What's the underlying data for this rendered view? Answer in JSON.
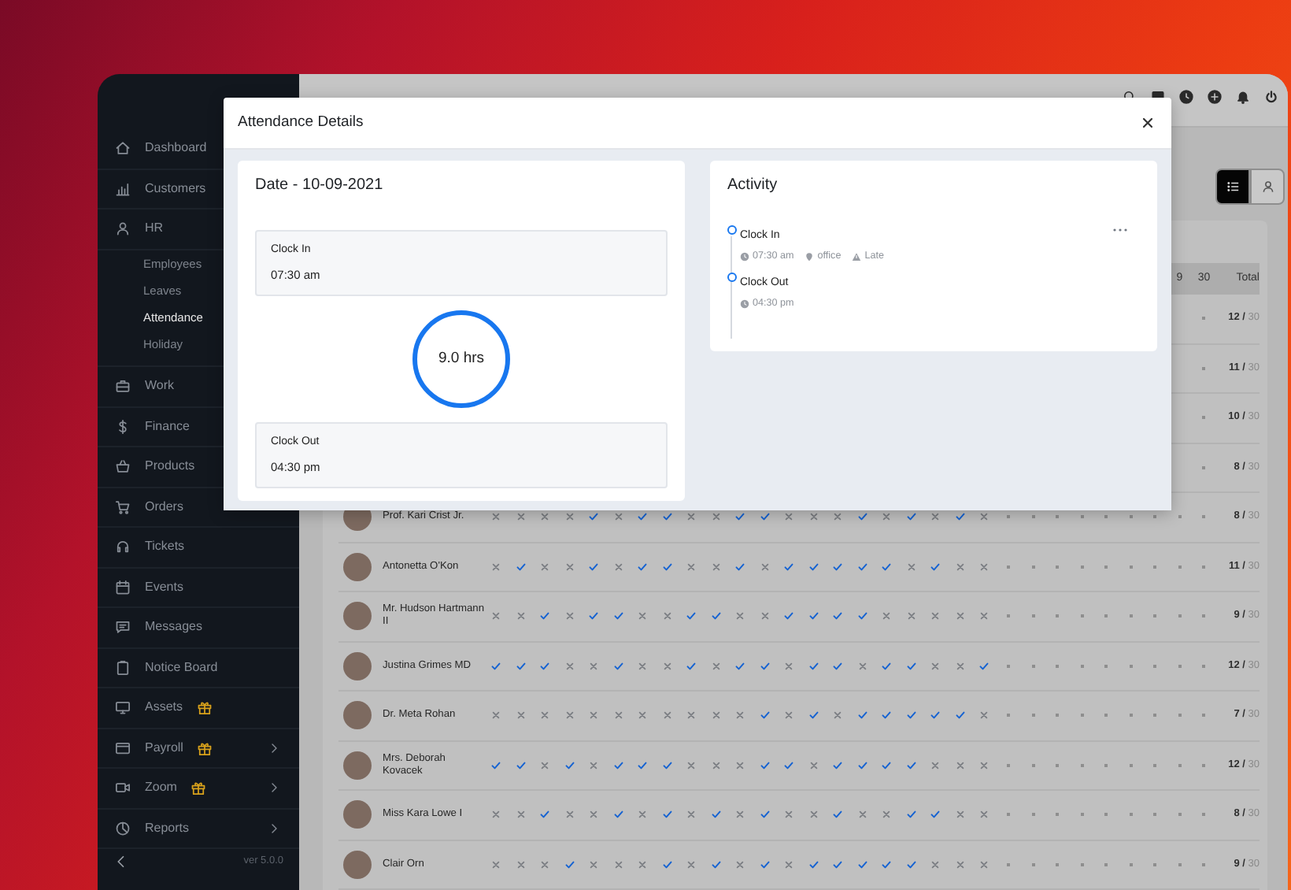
{
  "sidebar": {
    "items": [
      {
        "label": "Dashboard",
        "selected": false,
        "gift": false,
        "submenu": false
      },
      {
        "label": "Customers",
        "selected": false,
        "gift": false,
        "submenu": false
      },
      {
        "label": "HR",
        "selected": false,
        "gift": false,
        "submenu": false,
        "children": [
          {
            "label": "Employees",
            "selected": false
          },
          {
            "label": "Leaves",
            "selected": false
          },
          {
            "label": "Attendance",
            "selected": true
          },
          {
            "label": "Holiday",
            "selected": false
          }
        ]
      },
      {
        "label": "Work",
        "selected": false,
        "gift": false,
        "submenu": false
      },
      {
        "label": "Finance",
        "selected": false,
        "gift": false,
        "submenu": false
      },
      {
        "label": "Products",
        "selected": false,
        "gift": false,
        "submenu": false
      },
      {
        "label": "Orders",
        "selected": false,
        "gift": false,
        "submenu": false
      },
      {
        "label": "Tickets",
        "selected": false,
        "gift": false,
        "submenu": false
      },
      {
        "label": "Events",
        "selected": false,
        "gift": false,
        "submenu": false
      },
      {
        "label": "Messages",
        "selected": false,
        "gift": false,
        "submenu": false
      },
      {
        "label": "Notice Board",
        "selected": false,
        "gift": false,
        "submenu": false
      },
      {
        "label": "Assets",
        "selected": false,
        "gift": true,
        "submenu": false
      },
      {
        "label": "Payroll",
        "selected": false,
        "gift": true,
        "submenu": true
      },
      {
        "label": "Zoom",
        "selected": false,
        "gift": true,
        "submenu": true
      },
      {
        "label": "Reports",
        "selected": false,
        "gift": false,
        "submenu": true
      }
    ],
    "version": "ver 5.0.0"
  },
  "view_toggle": [
    {
      "selected": true
    },
    {
      "selected": false
    }
  ],
  "table": {
    "day_headings": [
      "9",
      "30"
    ],
    "total_heading": "Total",
    "rows": [
      {
        "days": [
          {
            "kind": "none"
          }
        ],
        "total": "**12 /** 30"
      },
      {
        "days": [
          {
            "kind": "none"
          }
        ],
        "total": "**11 /** 30"
      },
      {
        "days": [
          {
            "kind": "none"
          }
        ],
        "total": "**10 /** 30"
      },
      {
        "days": [
          {
            "kind": "none"
          }
        ],
        "total": "**8 /** 30"
      },
      {
        "name": "Prof. Kari Crist Jr.",
        "days": [
          {
            "kind": "absent"
          },
          {
            "kind": "absent"
          },
          {
            "kind": "absent"
          },
          {
            "kind": "absent"
          },
          {
            "kind": "present"
          },
          {
            "kind": "absent"
          },
          {
            "kind": "present"
          },
          {
            "kind": "present"
          },
          {
            "kind": "absent"
          },
          {
            "kind": "absent"
          },
          {
            "kind": "present"
          },
          {
            "kind": "present"
          },
          {
            "kind": "absent"
          },
          {
            "kind": "absent"
          },
          {
            "kind": "absent"
          },
          {
            "kind": "present"
          },
          {
            "kind": "absent"
          },
          {
            "kind": "present"
          },
          {
            "kind": "absent"
          },
          {
            "kind": "present"
          },
          {
            "kind": "absent"
          },
          {
            "kind": "none"
          },
          {
            "kind": "none"
          },
          {
            "kind": "none"
          },
          {
            "kind": "none"
          },
          {
            "kind": "none"
          },
          {
            "kind": "none"
          },
          {
            "kind": "none"
          },
          {
            "kind": "none"
          },
          {
            "kind": "none"
          }
        ],
        "total": "**8 /** 30"
      },
      {
        "name": "Antonetta O'Kon",
        "days": [
          {
            "kind": "absent"
          },
          {
            "kind": "present"
          },
          {
            "kind": "absent"
          },
          {
            "kind": "absent"
          },
          {
            "kind": "present"
          },
          {
            "kind": "absent"
          },
          {
            "kind": "present"
          },
          {
            "kind": "present"
          },
          {
            "kind": "absent"
          },
          {
            "kind": "absent"
          },
          {
            "kind": "present"
          },
          {
            "kind": "absent"
          },
          {
            "kind": "present"
          },
          {
            "kind": "present"
          },
          {
            "kind": "present"
          },
          {
            "kind": "present"
          },
          {
            "kind": "present"
          },
          {
            "kind": "absent"
          },
          {
            "kind": "present"
          },
          {
            "kind": "absent"
          },
          {
            "kind": "absent"
          },
          {
            "kind": "none"
          },
          {
            "kind": "none"
          },
          {
            "kind": "none"
          },
          {
            "kind": "none"
          },
          {
            "kind": "none"
          },
          {
            "kind": "none"
          },
          {
            "kind": "none"
          },
          {
            "kind": "none"
          },
          {
            "kind": "none"
          }
        ],
        "total": "**11 /** 30"
      },
      {
        "name": "Mr. Hudson Hartmann II",
        "days": [
          {
            "kind": "absent"
          },
          {
            "kind": "absent"
          },
          {
            "kind": "present"
          },
          {
            "kind": "absent"
          },
          {
            "kind": "present"
          },
          {
            "kind": "present"
          },
          {
            "kind": "absent"
          },
          {
            "kind": "absent"
          },
          {
            "kind": "present"
          },
          {
            "kind": "present"
          },
          {
            "kind": "absent"
          },
          {
            "kind": "absent"
          },
          {
            "kind": "present"
          },
          {
            "kind": "present"
          },
          {
            "kind": "present"
          },
          {
            "kind": "present"
          },
          {
            "kind": "absent"
          },
          {
            "kind": "absent"
          },
          {
            "kind": "absent"
          },
          {
            "kind": "absent"
          },
          {
            "kind": "absent"
          },
          {
            "kind": "none"
          },
          {
            "kind": "none"
          },
          {
            "kind": "none"
          },
          {
            "kind": "none"
          },
          {
            "kind": "none"
          },
          {
            "kind": "none"
          },
          {
            "kind": "none"
          },
          {
            "kind": "none"
          },
          {
            "kind": "none"
          }
        ],
        "total": "**9 /** 30"
      },
      {
        "name": "Justina Grimes MD",
        "days": [
          {
            "kind": "present"
          },
          {
            "kind": "present"
          },
          {
            "kind": "present"
          },
          {
            "kind": "absent"
          },
          {
            "kind": "absent"
          },
          {
            "kind": "present"
          },
          {
            "kind": "absent"
          },
          {
            "kind": "absent"
          },
          {
            "kind": "present"
          },
          {
            "kind": "absent"
          },
          {
            "kind": "present"
          },
          {
            "kind": "present"
          },
          {
            "kind": "absent"
          },
          {
            "kind": "present"
          },
          {
            "kind": "present"
          },
          {
            "kind": "absent"
          },
          {
            "kind": "present"
          },
          {
            "kind": "present"
          },
          {
            "kind": "absent"
          },
          {
            "kind": "absent"
          },
          {
            "kind": "present"
          },
          {
            "kind": "none"
          },
          {
            "kind": "none"
          },
          {
            "kind": "none"
          },
          {
            "kind": "none"
          },
          {
            "kind": "none"
          },
          {
            "kind": "none"
          },
          {
            "kind": "none"
          },
          {
            "kind": "none"
          },
          {
            "kind": "none"
          }
        ],
        "total": "**12 /** 30"
      },
      {
        "name": "Dr. Meta Rohan",
        "days": [
          {
            "kind": "absent"
          },
          {
            "kind": "absent"
          },
          {
            "kind": "absent"
          },
          {
            "kind": "absent"
          },
          {
            "kind": "absent"
          },
          {
            "kind": "absent"
          },
          {
            "kind": "absent"
          },
          {
            "kind": "absent"
          },
          {
            "kind": "absent"
          },
          {
            "kind": "absent"
          },
          {
            "kind": "absent"
          },
          {
            "kind": "present"
          },
          {
            "kind": "absent"
          },
          {
            "kind": "present"
          },
          {
            "kind": "absent"
          },
          {
            "kind": "present"
          },
          {
            "kind": "present"
          },
          {
            "kind": "present"
          },
          {
            "kind": "present"
          },
          {
            "kind": "present"
          },
          {
            "kind": "absent"
          },
          {
            "kind": "none"
          },
          {
            "kind": "none"
          },
          {
            "kind": "none"
          },
          {
            "kind": "none"
          },
          {
            "kind": "none"
          },
          {
            "kind": "none"
          },
          {
            "kind": "none"
          },
          {
            "kind": "none"
          },
          {
            "kind": "none"
          }
        ],
        "total": "**7 /** 30"
      },
      {
        "name": "Mrs. Deborah Kovacek",
        "days": [
          {
            "kind": "present"
          },
          {
            "kind": "present"
          },
          {
            "kind": "absent"
          },
          {
            "kind": "present"
          },
          {
            "kind": "absent"
          },
          {
            "kind": "present"
          },
          {
            "kind": "present"
          },
          {
            "kind": "present"
          },
          {
            "kind": "absent"
          },
          {
            "kind": "absent"
          },
          {
            "kind": "absent"
          },
          {
            "kind": "present"
          },
          {
            "kind": "present"
          },
          {
            "kind": "absent"
          },
          {
            "kind": "present"
          },
          {
            "kind": "present"
          },
          {
            "kind": "present"
          },
          {
            "kind": "present"
          },
          {
            "kind": "absent"
          },
          {
            "kind": "absent"
          },
          {
            "kind": "absent"
          },
          {
            "kind": "none"
          },
          {
            "kind": "none"
          },
          {
            "kind": "none"
          },
          {
            "kind": "none"
          },
          {
            "kind": "none"
          },
          {
            "kind": "none"
          },
          {
            "kind": "none"
          },
          {
            "kind": "none"
          },
          {
            "kind": "none"
          }
        ],
        "total": "**12 /** 30"
      },
      {
        "name": "Miss Kara Lowe I",
        "days": [
          {
            "kind": "absent"
          },
          {
            "kind": "absent"
          },
          {
            "kind": "present"
          },
          {
            "kind": "absent"
          },
          {
            "kind": "absent"
          },
          {
            "kind": "present"
          },
          {
            "kind": "absent"
          },
          {
            "kind": "present"
          },
          {
            "kind": "absent"
          },
          {
            "kind": "present"
          },
          {
            "kind": "absent"
          },
          {
            "kind": "present"
          },
          {
            "kind": "absent"
          },
          {
            "kind": "absent"
          },
          {
            "kind": "present"
          },
          {
            "kind": "absent"
          },
          {
            "kind": "absent"
          },
          {
            "kind": "present"
          },
          {
            "kind": "present"
          },
          {
            "kind": "absent"
          },
          {
            "kind": "absent"
          },
          {
            "kind": "none"
          },
          {
            "kind": "none"
          },
          {
            "kind": "none"
          },
          {
            "kind": "none"
          },
          {
            "kind": "none"
          },
          {
            "kind": "none"
          },
          {
            "kind": "none"
          },
          {
            "kind": "none"
          },
          {
            "kind": "none"
          }
        ],
        "total": "**8 /** 30"
      },
      {
        "name": "Clair Orn",
        "days": [
          {
            "kind": "absent"
          },
          {
            "kind": "absent"
          },
          {
            "kind": "absent"
          },
          {
            "kind": "present"
          },
          {
            "kind": "absent"
          },
          {
            "kind": "absent"
          },
          {
            "kind": "absent"
          },
          {
            "kind": "present"
          },
          {
            "kind": "absent"
          },
          {
            "kind": "present"
          },
          {
            "kind": "absent"
          },
          {
            "kind": "present"
          },
          {
            "kind": "absent"
          },
          {
            "kind": "present"
          },
          {
            "kind": "present"
          },
          {
            "kind": "present"
          },
          {
            "kind": "present"
          },
          {
            "kind": "present"
          },
          {
            "kind": "absent"
          },
          {
            "kind": "absent"
          },
          {
            "kind": "absent"
          },
          {
            "kind": "none"
          },
          {
            "kind": "none"
          },
          {
            "kind": "none"
          },
          {
            "kind": "none"
          },
          {
            "kind": "none"
          },
          {
            "kind": "none"
          },
          {
            "kind": "none"
          },
          {
            "kind": "none"
          },
          {
            "kind": "none"
          }
        ],
        "total": "**9 /** 30"
      }
    ]
  },
  "modal": {
    "title": "Attendance Details",
    "date_title": "Date - 10-09-2021",
    "clock_in": {
      "label": "Clock In",
      "value": "07:30 am"
    },
    "hours": "9.0 hrs",
    "clock_out": {
      "label": "Clock Out",
      "value": "04:30 pm"
    },
    "activity": {
      "title": "Activity",
      "entries": [
        {
          "title": "Clock In",
          "menu": true,
          "meta": [
            "07:30 am",
            "office",
            "Late"
          ]
        },
        {
          "title": "Clock Out",
          "menu": false,
          "meta": [
            "04:30 pm"
          ]
        }
      ]
    }
  }
}
